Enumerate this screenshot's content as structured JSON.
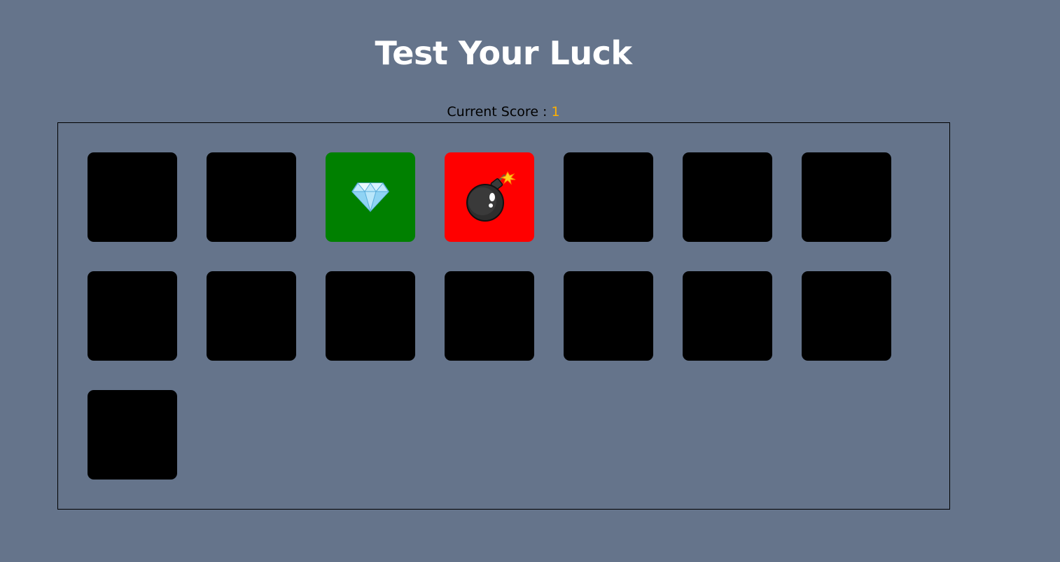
{
  "title": "Test Your Luck",
  "score": {
    "label": "Current Score :",
    "value": "1"
  },
  "colors": {
    "background": "#65748b",
    "hidden_tile": "#000000",
    "gem_tile": "#008000",
    "bomb_tile": "#ff0000",
    "score_value": "#ffb000"
  },
  "tiles": [
    {
      "state": "hidden"
    },
    {
      "state": "hidden"
    },
    {
      "state": "gem",
      "icon": "diamond-icon"
    },
    {
      "state": "bomb",
      "icon": "bomb-icon"
    },
    {
      "state": "hidden"
    },
    {
      "state": "hidden"
    },
    {
      "state": "hidden"
    },
    {
      "state": "hidden"
    },
    {
      "state": "hidden"
    },
    {
      "state": "hidden"
    },
    {
      "state": "hidden"
    },
    {
      "state": "hidden"
    },
    {
      "state": "hidden"
    },
    {
      "state": "hidden"
    },
    {
      "state": "hidden"
    }
  ]
}
